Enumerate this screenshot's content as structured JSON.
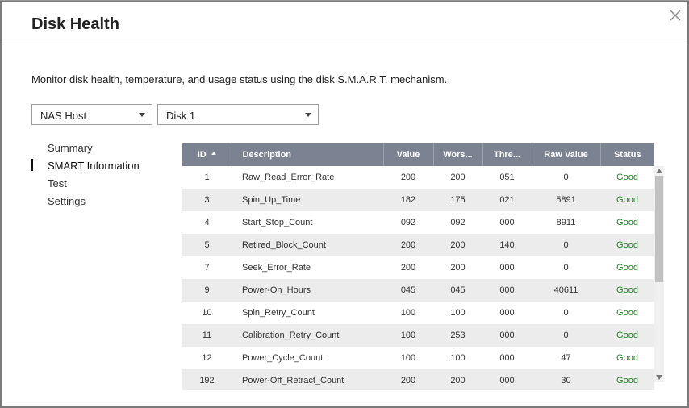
{
  "dialog": {
    "title": "Disk Health",
    "description": "Monitor disk health, temperature, and usage status using the disk S.M.A.R.T. mechanism."
  },
  "selectors": {
    "host": "NAS Host",
    "disk": "Disk 1"
  },
  "nav": {
    "items": [
      {
        "label": "Summary"
      },
      {
        "label": "SMART Information"
      },
      {
        "label": "Test"
      },
      {
        "label": "Settings"
      }
    ],
    "active_index": 1
  },
  "table": {
    "headers": {
      "id": "ID",
      "description": "Description",
      "value": "Value",
      "worst": "Wors...",
      "threshold": "Thre...",
      "raw_value": "Raw Value",
      "status": "Status"
    },
    "sort": {
      "column": "ID",
      "direction": "ascending"
    },
    "rows": [
      {
        "id": "1",
        "description": "Raw_Read_Error_Rate",
        "value": "200",
        "worst": "200",
        "threshold": "051",
        "raw_value": "0",
        "status": "Good"
      },
      {
        "id": "3",
        "description": "Spin_Up_Time",
        "value": "182",
        "worst": "175",
        "threshold": "021",
        "raw_value": "5891",
        "status": "Good"
      },
      {
        "id": "4",
        "description": "Start_Stop_Count",
        "value": "092",
        "worst": "092",
        "threshold": "000",
        "raw_value": "8911",
        "status": "Good"
      },
      {
        "id": "5",
        "description": "Retired_Block_Count",
        "value": "200",
        "worst": "200",
        "threshold": "140",
        "raw_value": "0",
        "status": "Good"
      },
      {
        "id": "7",
        "description": "Seek_Error_Rate",
        "value": "200",
        "worst": "200",
        "threshold": "000",
        "raw_value": "0",
        "status": "Good"
      },
      {
        "id": "9",
        "description": "Power-On_Hours",
        "value": "045",
        "worst": "045",
        "threshold": "000",
        "raw_value": "40611",
        "status": "Good"
      },
      {
        "id": "10",
        "description": "Spin_Retry_Count",
        "value": "100",
        "worst": "100",
        "threshold": "000",
        "raw_value": "0",
        "status": "Good"
      },
      {
        "id": "11",
        "description": "Calibration_Retry_Count",
        "value": "100",
        "worst": "253",
        "threshold": "000",
        "raw_value": "0",
        "status": "Good"
      },
      {
        "id": "12",
        "description": "Power_Cycle_Count",
        "value": "100",
        "worst": "100",
        "threshold": "000",
        "raw_value": "47",
        "status": "Good"
      },
      {
        "id": "192",
        "description": "Power-Off_Retract_Count",
        "value": "200",
        "worst": "200",
        "threshold": "000",
        "raw_value": "30",
        "status": "Good"
      }
    ]
  },
  "colors": {
    "header_bg": "#7b8292",
    "status_good": "#1e8a1e",
    "row_alt": "#ececec"
  },
  "icons": {
    "close": "close-icon",
    "dropdown": "chevron-down-icon",
    "sort": "sort-ascending-icon"
  }
}
